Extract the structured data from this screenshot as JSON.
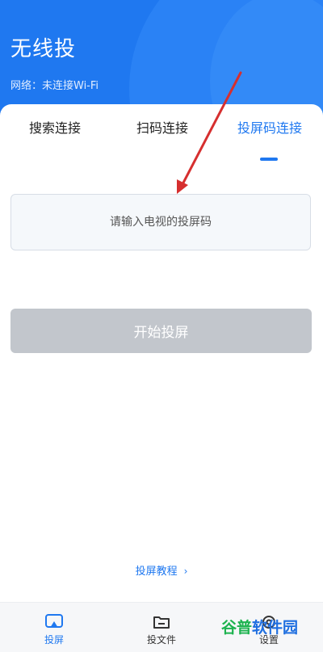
{
  "header": {
    "title": "无线投",
    "network_status": "网络：未连接Wi-Fi"
  },
  "tabs": [
    {
      "label": "搜索连接"
    },
    {
      "label": "扫码连接"
    },
    {
      "label": "投屏码连接"
    }
  ],
  "code_input": {
    "placeholder": "请输入电视的投屏码"
  },
  "start_button": {
    "label": "开始投屏"
  },
  "tutorial_link": {
    "label": "投屏教程",
    "chevron": "›"
  },
  "bottom_nav": [
    {
      "label": "投屏",
      "icon": "cast-screen-icon"
    },
    {
      "label": "投文件",
      "icon": "folder-icon"
    },
    {
      "label": "设置",
      "icon": "settings-icon"
    }
  ],
  "watermark": {
    "part1": "谷普",
    "part2": "软件园"
  },
  "colors": {
    "accent": "#1f78f0",
    "header_bg": "#1f78f0",
    "button_disabled": "#c2c6cc",
    "annotation_arrow": "#d62f2f"
  }
}
